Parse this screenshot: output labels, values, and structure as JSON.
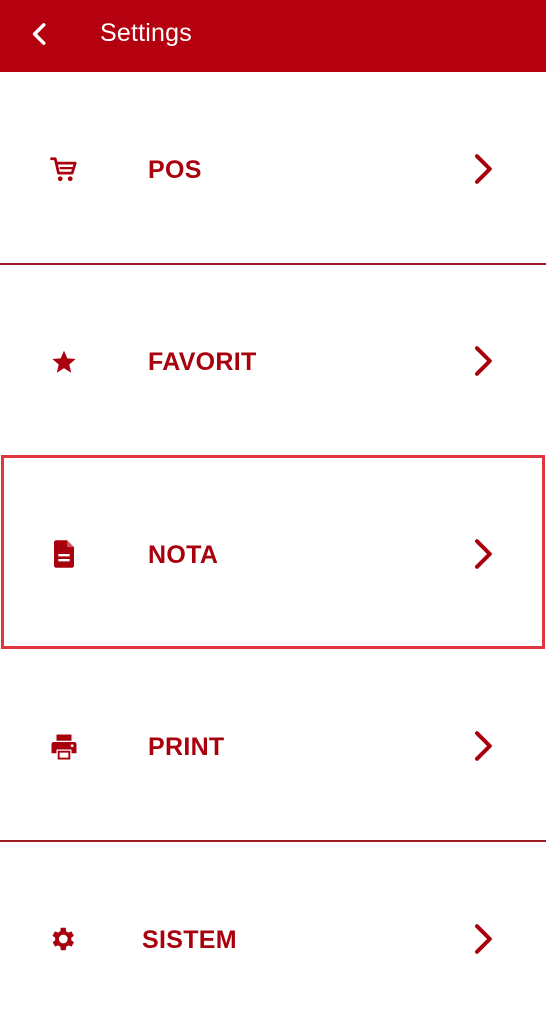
{
  "appbar": {
    "title": "Settings",
    "background_color": "#b5000f",
    "back_icon": "chevron-left-icon"
  },
  "menu": {
    "accent_color": "#a8000c",
    "items": [
      {
        "id": "pos",
        "label": "POS",
        "icon": "cart-icon"
      },
      {
        "id": "favorit",
        "label": "FAVORIT",
        "icon": "star-icon"
      },
      {
        "id": "nota",
        "label": "NOTA",
        "icon": "document-icon",
        "highlighted": true
      },
      {
        "id": "print",
        "label": "PRINT",
        "icon": "printer-icon"
      },
      {
        "id": "sistem",
        "label": "SISTEM",
        "icon": "gear-icon"
      }
    ]
  },
  "highlight_color": "#e0363f"
}
